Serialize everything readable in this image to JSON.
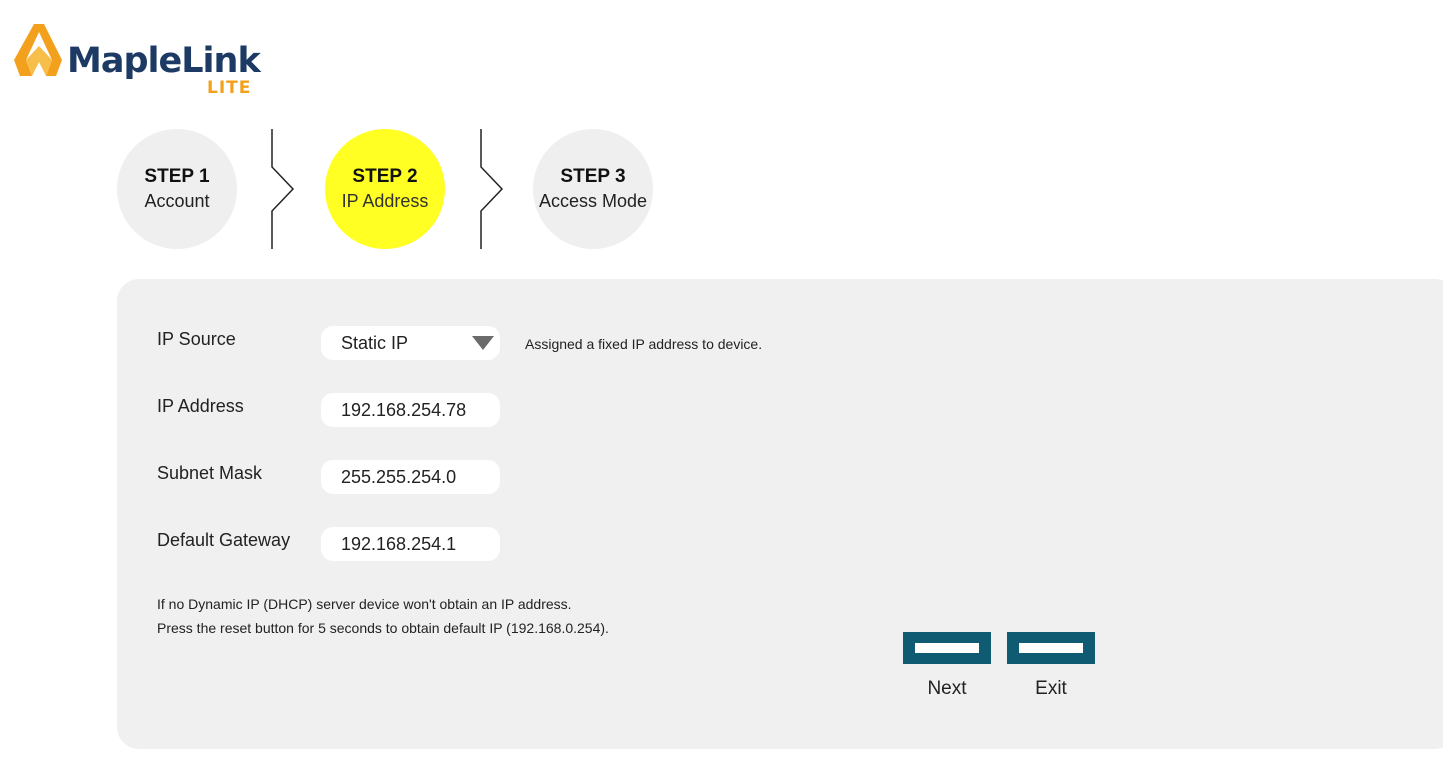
{
  "logo": {
    "brand": "MapleLink",
    "edition": "LITE",
    "colors": {
      "wordmark": "#1c3a63",
      "accent": "#f3a11d"
    }
  },
  "steps": [
    {
      "number": "STEP 1",
      "label": "Account",
      "active": false
    },
    {
      "number": "STEP 2",
      "label": "IP Address",
      "active": true
    },
    {
      "number": "STEP 3",
      "label": "Access Mode",
      "active": false
    }
  ],
  "form": {
    "ip_source": {
      "label": "IP Source",
      "value": "Static IP",
      "hint": "Assigned a fixed IP address to device."
    },
    "ip_address": {
      "label": "IP Address",
      "value": "192.168.254.78"
    },
    "subnet_mask": {
      "label": "Subnet Mask",
      "value": "255.255.254.0"
    },
    "default_gateway": {
      "label": "Default Gateway",
      "value": "192.168.254.1"
    }
  },
  "notes": [
    "If no Dynamic IP (DHCP) server device won't obtain an IP address.",
    "Press the reset button for 5 seconds to obtain default IP (192.168.0.254)."
  ],
  "buttons": {
    "next": "Next",
    "exit": "Exit"
  },
  "colors": {
    "active_step": "#ffff24",
    "inactive_step": "#efefef",
    "button": "#0f5b71",
    "panel": "#f0f0f0"
  }
}
